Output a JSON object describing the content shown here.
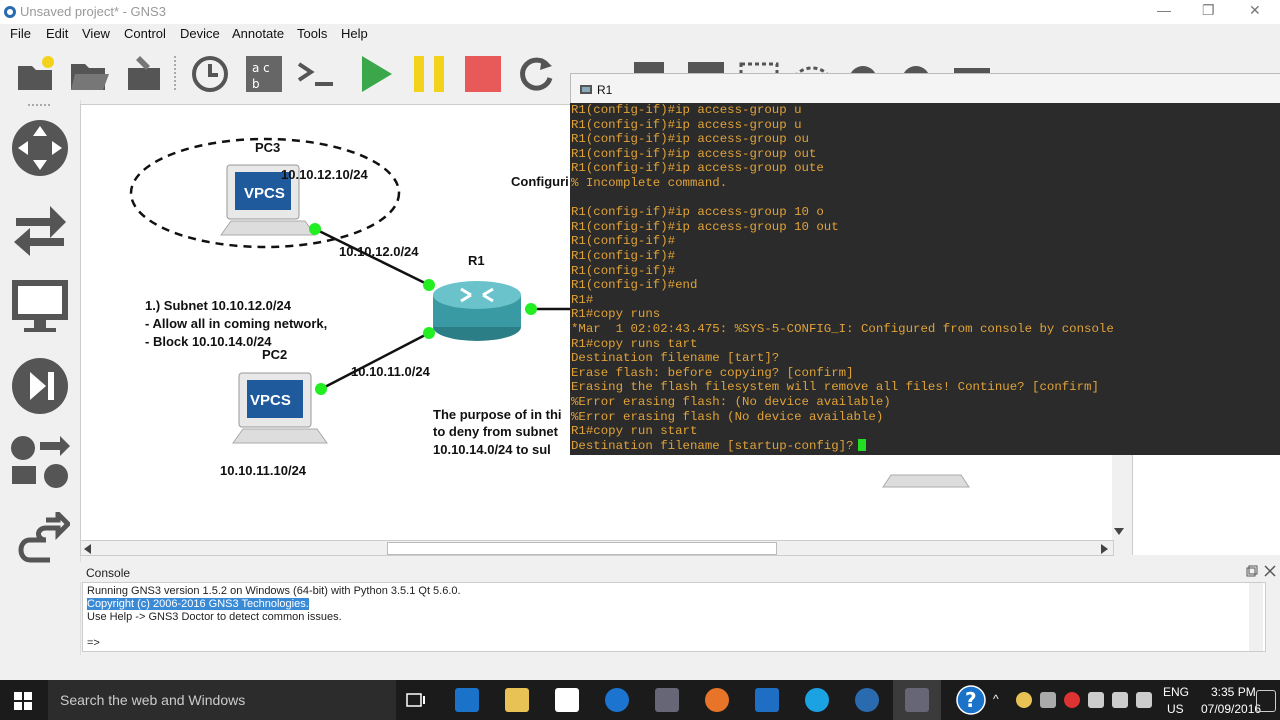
{
  "window": {
    "title": "Unsaved project* - GNS3",
    "minimize": "—",
    "restore": "❐",
    "close": "✕"
  },
  "menu": [
    "File",
    "Edit",
    "View",
    "Control",
    "Device",
    "Annotate",
    "Tools",
    "Help"
  ],
  "canvas": {
    "pc3_label": "PC3",
    "pc3_ip": "10.10.12.10/24",
    "link_pc3": "10.10.12.0/24",
    "r1_label": "R1",
    "pc2_label": "PC2",
    "pc2_ip": "10.10.11.10/24",
    "link_pc2": "10.10.11.0/24",
    "vpcs": "VPCS",
    "config_partial": "Configuri",
    "note": [
      "1.) Subnet 10.10.12.0/24",
      "- Allow all in coming network,",
      "- Block 10.10.14.0/24"
    ],
    "purpose": [
      "The purpose of in thi",
      "to deny from subnet",
      "10.10.14.0/24 to sul"
    ]
  },
  "terminal": {
    "title": "R1",
    "lines": [
      "R1(config-if)#ip access-group u",
      "R1(config-if)#ip access-group u",
      "R1(config-if)#ip access-group ou",
      "R1(config-if)#ip access-group out",
      "R1(config-if)#ip access-group oute",
      "% Incomplete command.",
      "",
      "R1(config-if)#ip access-group 10 o",
      "R1(config-if)#ip access-group 10 out",
      "R1(config-if)#",
      "R1(config-if)#",
      "R1(config-if)#",
      "R1(config-if)#end",
      "R1#",
      "R1#copy runs",
      "*Mar  1 02:02:43.475: %SYS-5-CONFIG_I: Configured from console by console",
      "R1#copy runs tart",
      "Destination filename [tart]?",
      "Erase flash: before copying? [confirm]",
      "Erasing the flash filesystem will remove all files! Continue? [confirm]",
      "%Error erasing flash: (No device available)",
      "%Error erasing flash (No device available)",
      "R1#copy run start",
      "Destination filename [startup-config]?"
    ]
  },
  "console": {
    "title": "Console",
    "lines": [
      "Running GNS3 version 1.5.2 on Windows (64-bit) with Python 3.5.1 Qt 5.6.0.",
      "Copyright (c) 2006-2016 GNS3 Technologies.",
      "Use Help -> GNS3 Doctor to detect common issues.",
      "",
      "=>"
    ]
  },
  "taskbar": {
    "search_placeholder": "Search the web and Windows",
    "lang": "ENG",
    "region": "US",
    "time": "3:35 PM",
    "date": "07/09/2016"
  },
  "colors": {
    "terminal_text": "#e0a238",
    "terminal_bg": "#2b2b2b",
    "link_dot": "#22ee22",
    "accent": "#3a8ad6"
  }
}
